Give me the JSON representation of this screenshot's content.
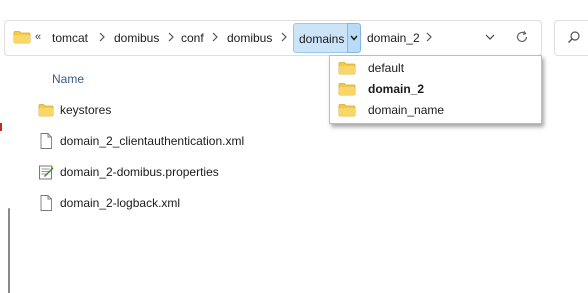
{
  "address_bar": {
    "overflow": "«",
    "crumbs": [
      "tomcat",
      "domibus",
      "conf",
      "domibus",
      "domains",
      "domain_2"
    ],
    "active_crumb": "domains"
  },
  "file_list": {
    "column_header": "Name",
    "items": [
      {
        "name": "keystores",
        "icon": "folder-icon"
      },
      {
        "name": "domain_2_clientauthentication.xml",
        "icon": "document-icon"
      },
      {
        "name": "domain_2-domibus.properties",
        "icon": "properties-file-icon"
      },
      {
        "name": "domain_2-logback.xml",
        "icon": "document-icon"
      }
    ]
  },
  "dropdown": {
    "items": [
      {
        "label": "default",
        "bold": false
      },
      {
        "label": "domain_2",
        "bold": true
      },
      {
        "label": "domain_name",
        "bold": false
      }
    ]
  },
  "colors": {
    "folder": "#f2c94c",
    "active_crumb_bg": "#cce4f7",
    "active_crumb_border": "#99c8ee"
  }
}
